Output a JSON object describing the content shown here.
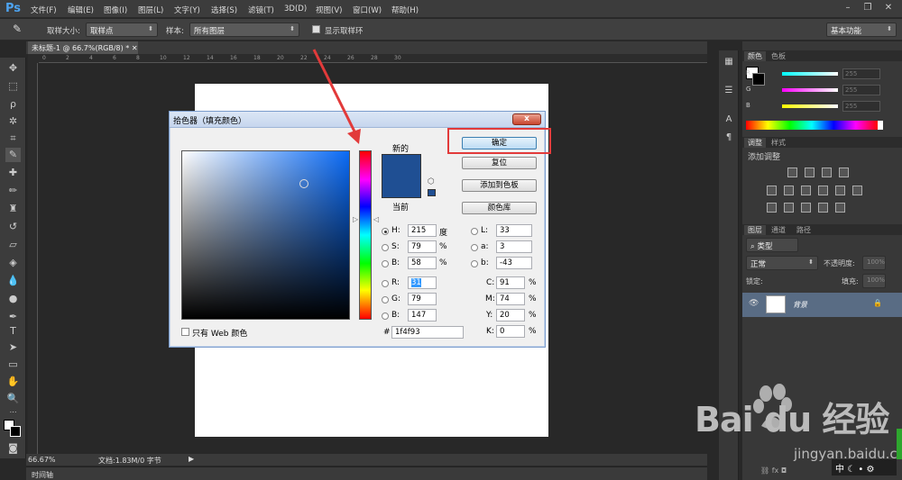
{
  "app": {
    "logo": "Ps"
  },
  "menu": [
    "文件(F)",
    "编辑(E)",
    "图像(I)",
    "图层(L)",
    "文字(Y)",
    "选择(S)",
    "滤镜(T)",
    "3D(D)",
    "视图(V)",
    "窗口(W)",
    "帮助(H)"
  ],
  "options": {
    "sample_size_label": "取样大小:",
    "sample_size_value": "取样点",
    "sample_label": "样本:",
    "sample_value": "所有图层",
    "show_ring_label": "显示取样环",
    "workspace": "基本功能"
  },
  "document": {
    "tab_title": "未标题-1 @ 66.7%(RGB/8) *",
    "ruler_ticks": [
      "0",
      "2",
      "4",
      "6",
      "8",
      "10",
      "12",
      "14",
      "16",
      "18",
      "20",
      "22",
      "24",
      "26",
      "28",
      "30"
    ],
    "zoom": "66.67%",
    "doc_info": "文档:1.83M/0 字节",
    "timeline_tab": "时间轴"
  },
  "color_panel": {
    "tabs": [
      "颜色",
      "色板"
    ],
    "sliders": [
      {
        "label": "R",
        "value": "255"
      },
      {
        "label": "G",
        "value": "255"
      },
      {
        "label": "B",
        "value": "255"
      }
    ]
  },
  "adjust_panel": {
    "tabs": [
      "调整",
      "样式"
    ],
    "title": "添加调整"
  },
  "layers_panel": {
    "tabs": [
      "图层",
      "通道",
      "路径"
    ],
    "filter_label": "类型",
    "blend_mode": "正常",
    "opacity_label": "不透明度:",
    "opacity_value": "100%",
    "lock_label": "锁定:",
    "fill_label": "填充:",
    "fill_value": "100%",
    "layer_name": "背景"
  },
  "dialog": {
    "title": "拾色器（填充颜色）",
    "close": "x",
    "new_label": "新的",
    "current_label": "当前",
    "buttons": {
      "ok": "确定",
      "reset": "复位",
      "add_swatch": "添加到色板",
      "color_libs": "颜色库"
    },
    "hsb": [
      {
        "label": "H:",
        "value": "215",
        "unit": "度"
      },
      {
        "label": "S:",
        "value": "79",
        "unit": "%"
      },
      {
        "label": "B:",
        "value": "58",
        "unit": "%"
      }
    ],
    "rgb": [
      {
        "label": "R:",
        "value": "31"
      },
      {
        "label": "G:",
        "value": "79"
      },
      {
        "label": "B:",
        "value": "147"
      }
    ],
    "lab": [
      {
        "label": "L:",
        "value": "33"
      },
      {
        "label": "a:",
        "value": "3"
      },
      {
        "label": "b:",
        "value": "-43"
      }
    ],
    "cmyk": [
      {
        "label": "C:",
        "value": "91",
        "unit": "%"
      },
      {
        "label": "M:",
        "value": "74",
        "unit": "%"
      },
      {
        "label": "Y:",
        "value": "20",
        "unit": "%"
      },
      {
        "label": "K:",
        "value": "0",
        "unit": "%"
      }
    ],
    "hex_label": "#",
    "hex_value": "1f4f93",
    "web_only_label": "只有 Web 颜色",
    "selected_color": "#1f4f93"
  },
  "watermark": {
    "text": "Bai du 经验",
    "url": "jingyan.baidu.com"
  },
  "taskbar": {
    "ime": "中"
  }
}
